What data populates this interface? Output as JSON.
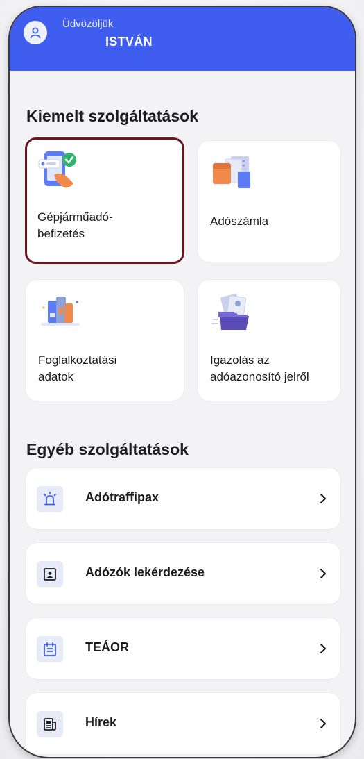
{
  "header": {
    "greeting": "Üdvözöljük",
    "user_name": "ISTVÁN",
    "background_color": "#3f5ef0"
  },
  "featured": {
    "title": "Kiemelt szolgáltatások",
    "items": [
      {
        "label_line1": "Gépjárműadó-",
        "label_line2": "befizetés",
        "icon": "phone-payment-icon",
        "highlighted": true
      },
      {
        "label_line1": "Adószámla",
        "label_line2": "",
        "icon": "documents-icon",
        "highlighted": false
      },
      {
        "label_line1": "Foglalkoztatási",
        "label_line2": "adatok",
        "icon": "folders-icon",
        "highlighted": false
      },
      {
        "label_line1": "Igazolás az",
        "label_line2": "adóazonosító jelről",
        "icon": "certificate-folder-icon",
        "highlighted": false
      }
    ],
    "highlight_color": "#6e1620"
  },
  "other": {
    "title": "Egyéb szolgáltatások",
    "items": [
      {
        "label": "Adótraffipax",
        "icon": "siren-icon"
      },
      {
        "label": "Adózók lekérdezése",
        "icon": "contact-card-icon"
      },
      {
        "label": "TEÁOR",
        "icon": "calendar-list-icon"
      },
      {
        "label": "Hírek",
        "icon": "newspaper-icon"
      }
    ]
  }
}
